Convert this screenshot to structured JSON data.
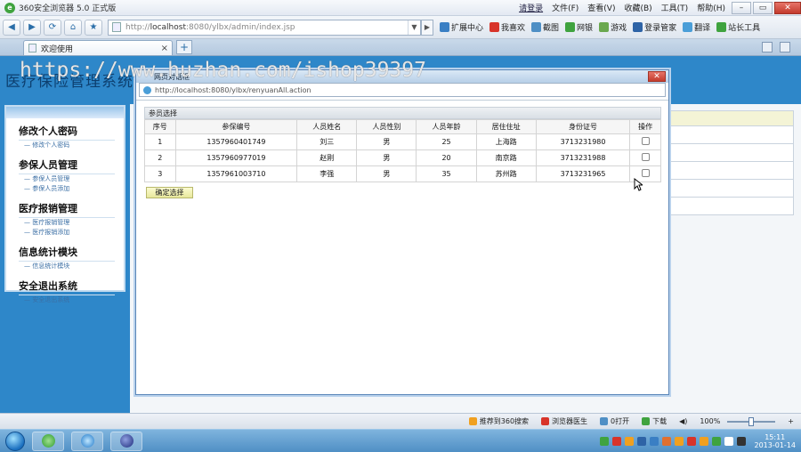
{
  "browser": {
    "title": "360安全浏览器 5.0 正式版",
    "menu": [
      "请登录",
      "文件(F)",
      "查看(V)",
      "收藏(B)",
      "工具(T)",
      "帮助(H)"
    ],
    "address_prefix": "http://",
    "address_host": "localhost",
    "address_rest": ":8080/ylbx/admin/index.jsp",
    "toolbar": [
      "扩展中心",
      "我喜欢",
      "截图",
      "网银",
      "游戏",
      "登录管家",
      "翻译",
      "站长工具"
    ],
    "tab_label": "欢迎使用",
    "status": [
      "推荐到360搜索",
      "浏览器医生",
      "0打开",
      "下载"
    ],
    "zoom": "100%"
  },
  "page": {
    "heading": "医疗保险管理系统"
  },
  "sidebar": {
    "groups": [
      {
        "title": "修改个人密码",
        "items": [
          "修改个人密码"
        ]
      },
      {
        "title": "参保人员管理",
        "items": [
          "参保人员管理",
          "参保人员添加"
        ]
      },
      {
        "title": "医疗报销管理",
        "items": [
          "医疗报销管理",
          "医疗报销添加"
        ]
      },
      {
        "title": "信息统计模块",
        "items": [
          "信息统计模块"
        ]
      },
      {
        "title": "安全退出系统",
        "items": [
          "安全退出系统"
        ]
      }
    ]
  },
  "popup": {
    "title": "网页对话框",
    "url": "http://localhost:8080/ylbx/renyuanAll.action",
    "panel_title": "参员选择",
    "columns": [
      "序号",
      "参保编号",
      "人员姓名",
      "人员性别",
      "人员年龄",
      "居住住址",
      "身份证号",
      "操作"
    ],
    "rows": [
      [
        "1",
        "1357960401749",
        "刘三",
        "男",
        "25",
        "上海路",
        "3713231980"
      ],
      [
        "2",
        "1357960977019",
        "赵刚",
        "男",
        "20",
        "南京路",
        "3713231988"
      ],
      [
        "3",
        "1357961003710",
        "李强",
        "男",
        "35",
        "苏州路",
        "3713231965"
      ]
    ],
    "confirm_label": "确定选择"
  },
  "taskbar": {
    "time": "15:11",
    "date": "2013-01-14"
  },
  "watermark": "https://www.huzhan.com/ishop39397"
}
